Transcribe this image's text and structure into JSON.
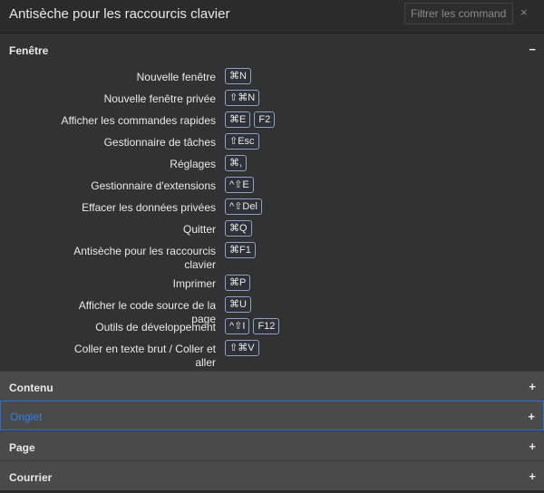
{
  "header": {
    "title": "Antisèche pour les raccourcis clavier",
    "filter_placeholder": "Filtrer les commandes",
    "close_glyph": "×"
  },
  "sections": {
    "fenetre": {
      "title": "Fenêtre",
      "toggle": "−",
      "shortcuts": [
        {
          "label": "Nouvelle fenêtre",
          "keys": [
            "⌘N"
          ]
        },
        {
          "label": "Nouvelle fenêtre privée",
          "keys": [
            "⇧⌘N"
          ]
        },
        {
          "label": "Afficher les commandes rapides",
          "keys": [
            "⌘E",
            "F2"
          ]
        },
        {
          "label": "Gestionnaire de tâches",
          "keys": [
            "⇧Esc"
          ]
        },
        {
          "label": "Réglages",
          "keys": [
            "⌘,"
          ]
        },
        {
          "label": "Gestionnaire d'extensions",
          "keys": [
            "^⇧E"
          ]
        },
        {
          "label": "Effacer les données privées",
          "keys": [
            "^⇧Del"
          ]
        },
        {
          "label": "Quitter",
          "keys": [
            "⌘Q"
          ]
        },
        {
          "label": "Antisèche pour les raccourcis clavier",
          "keys": [
            "⌘F1"
          ]
        },
        {
          "label": "Imprimer",
          "keys": [
            "⌘P"
          ]
        },
        {
          "label": "Afficher le code source de la page",
          "keys": [
            "⌘U"
          ]
        },
        {
          "label": "Outils de développement",
          "keys": [
            "^⇧I",
            "F12"
          ]
        },
        {
          "label": "Coller en texte brut / Coller et aller",
          "keys": [
            "⇧⌘V"
          ]
        }
      ]
    },
    "contenu": {
      "title": "Contenu",
      "toggle": "+"
    },
    "onglet": {
      "title": "Onglet",
      "toggle": "+"
    },
    "page": {
      "title": "Page",
      "toggle": "+"
    },
    "courrier": {
      "title": "Courrier",
      "toggle": "+"
    }
  },
  "colors": {
    "background": "#2b2b2b",
    "section_closed": "#4a4a4a",
    "accent_blue": "#2a82e4",
    "key_border": "#8ea2bf"
  }
}
